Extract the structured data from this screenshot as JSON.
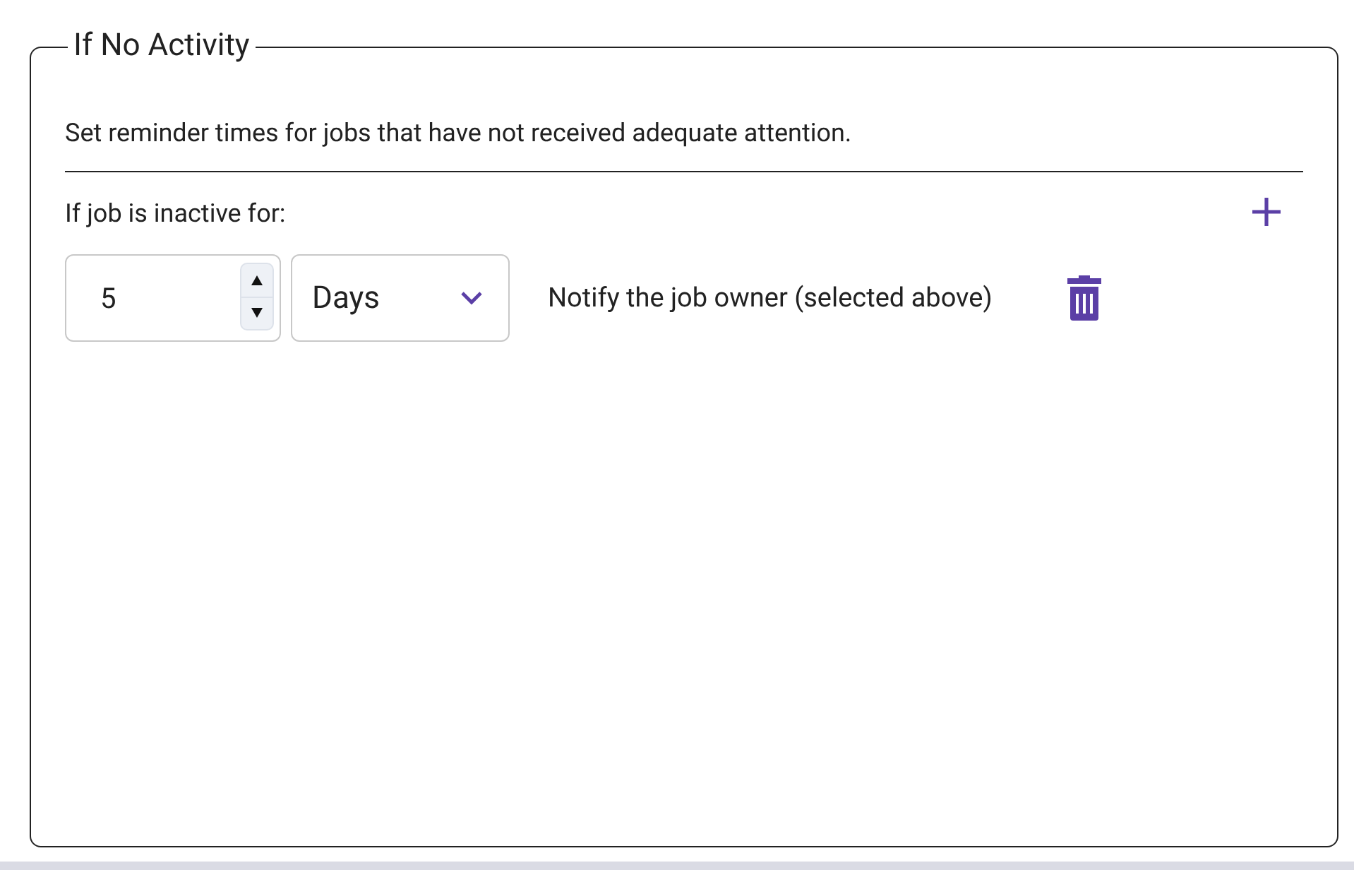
{
  "section": {
    "title": "If No Activity",
    "description": "Set reminder times for jobs that have not received adequate attention.",
    "inactive_label": "If job is inactive for:"
  },
  "reminders": [
    {
      "amount": "5",
      "unit": "Days",
      "action": "Notify the job owner (selected above)"
    }
  ]
}
